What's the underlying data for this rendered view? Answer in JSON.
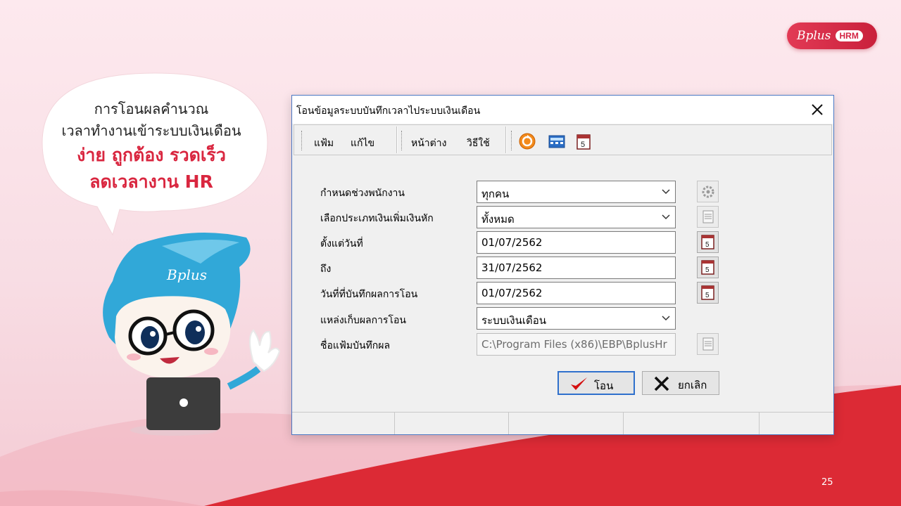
{
  "slide": {
    "bubble_lines": [
      "การโอนผลคำนวณ",
      "เวลาทำงานเข้าระบบเงินเดือน"
    ],
    "bubble_highlight": [
      "ง่าย ถูกต้อง รวดเร็ว",
      "ลดเวลางาน HR"
    ],
    "page_number": "25"
  },
  "logo": {
    "word": "Bplus",
    "badge": "HRM"
  },
  "mascot": {
    "word": "Bplus"
  },
  "dialog": {
    "title": "โอนข้อมูลระบบบันทึกเวลาไประบบเงินเดือน",
    "menu": [
      "แฟ้ม",
      "แก้ไข",
      "หน้าต่าง",
      "วิธีใช้"
    ],
    "toolbar_icons": [
      "orange-refresh-icon",
      "calculator-icon",
      "calendar-icon"
    ],
    "fields": [
      {
        "label": "กำหนดช่วงพนักงาน",
        "value": "ทุกคน"
      },
      {
        "label": "เลือกประเภทเงินเพิ่มเงินหัก",
        "value": "ทั้งหมด"
      },
      {
        "label": "ตั้งแต่วันที่",
        "value": "01/07/2562"
      },
      {
        "label": "ถึง",
        "value": "31/07/2562"
      },
      {
        "label": "วันที่ที่บันทึกผลการโอน",
        "value": "01/07/2562"
      },
      {
        "label": "แหล่งเก็บผลการโอน",
        "value": "ระบบเงินเดือน"
      },
      {
        "label": "ชื่อแฟ้มบันทึกผล",
        "value": "C:\\Program Files (x86)\\EBP\\BplusHr"
      }
    ],
    "ok_label": "โอน",
    "cancel_label": "ยกเลิก"
  },
  "colors": {
    "accent": "#d9263f",
    "dialog_border": "#4a78c4",
    "default_button_border": "#2f70cc"
  }
}
